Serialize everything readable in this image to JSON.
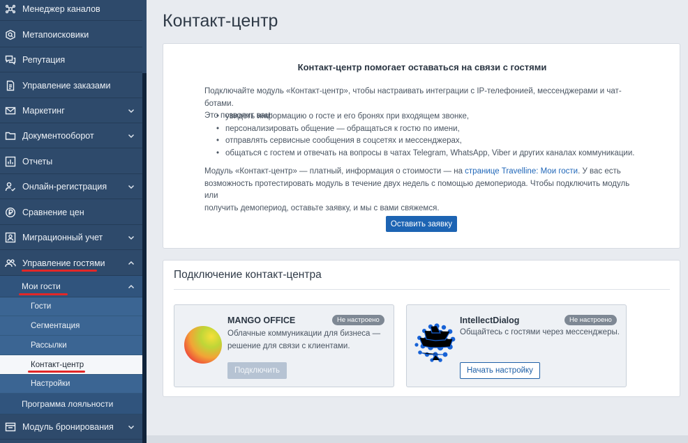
{
  "sidebar": {
    "items": [
      {
        "label": "Менеджер каналов",
        "icon": "cube-network-icon"
      },
      {
        "label": "Метапоисковики",
        "icon": "metasearch-icon"
      },
      {
        "label": "Репутация",
        "icon": "chat-bubbles-icon"
      },
      {
        "label": "Управление заказами",
        "icon": "document-icon"
      },
      {
        "label": "Маркетинг",
        "icon": "envelope-icon"
      },
      {
        "label": "Документооборот",
        "icon": "folder-icon"
      },
      {
        "label": "Отчеты",
        "icon": "bar-chart-icon"
      },
      {
        "label": "Онлайн-регистрация",
        "icon": "user-check-icon"
      },
      {
        "label": "Сравнение цен",
        "icon": "price-compare-icon"
      },
      {
        "label": "Миграционный учет",
        "icon": "id-card-icon"
      },
      {
        "label": "Управление гостями",
        "icon": "users-icon"
      }
    ],
    "my_guests": "Мои гости",
    "sub_items": [
      "Гости",
      "Сегментация",
      "Рассылки",
      "Контакт-центр",
      "Настройки"
    ],
    "loyalty": "Программа лояльности",
    "booking": {
      "label": "Модуль бронирования",
      "icon": "booking-module-icon"
    }
  },
  "page": {
    "title": "Контакт-центр"
  },
  "info": {
    "heading": "Контакт-центр помогает оставаться на связи с гостями",
    "intro_line1": "Подключайте модуль «Контакт-центр», чтобы настраивать интеграции с IP-телефонией, мессенджерами и чат-ботами.",
    "intro_line2": "Это позволит вам:",
    "bullets": [
      "увидеть информацию о госте и его бронях при входящем звонке,",
      "персонализировать общение — обращаться к гостю по имени,",
      "отправлять сервисные сообщения в соцсетях и мессенджерах,",
      "общаться с гостем и отвечать на вопросы в чатах Telegram, WhatsApp, Viber и других каналах коммуникации."
    ],
    "pricing_prefix": "Модуль «Контакт-центр» — платный, информация о стоимости — на ",
    "pricing_link": "странице Travelline: Мои гости",
    "pricing_suffix": ". У вас есть",
    "pricing_line2": "возможность протестировать модуль в течение двух недель с помощью демопериода. Чтобы подключить модуль или",
    "pricing_line3": "получить демопериод, оставьте заявку, и мы с вами свяжемся.",
    "button": "Оставить заявку"
  },
  "connect": {
    "title": "Подключение контакт-центра",
    "providers": [
      {
        "name": "MANGO OFFICE",
        "status": "Не настроено",
        "desc_line1": "Облачные коммуникации для бизнеса —",
        "desc_line2": "решение для связи с клиентами.",
        "button": "Подключить"
      },
      {
        "name": "IntellectDialog",
        "status": "Не настроено",
        "desc_line1": "Общайтесь с гостями через мессенджеры.",
        "button": "Начать настройку"
      }
    ]
  },
  "colors": {
    "sidebar": "#2e4a6b",
    "accent": "#1d64b3",
    "highlight": "#e32727",
    "badge": "#7e8894"
  }
}
